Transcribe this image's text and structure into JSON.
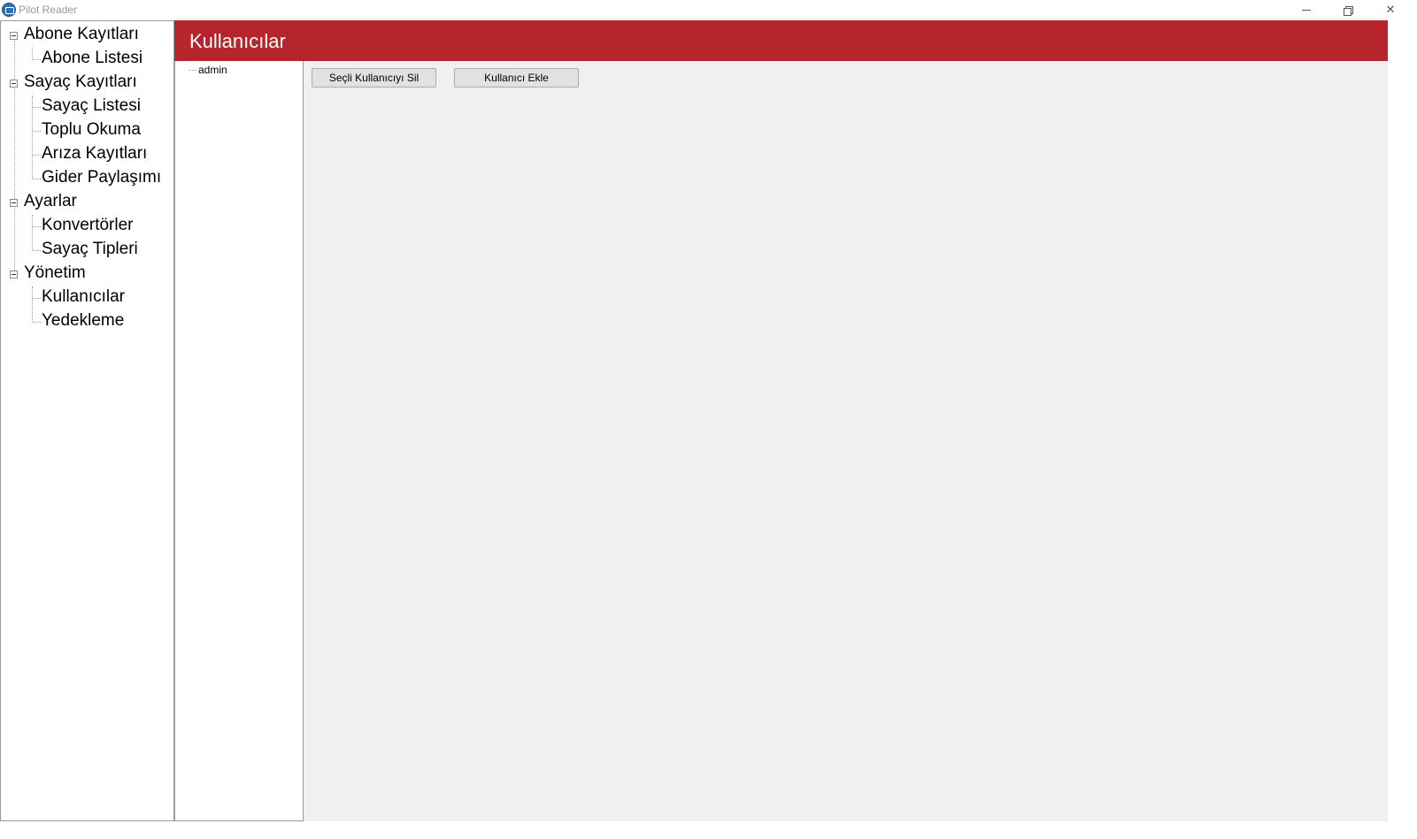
{
  "window": {
    "title": "Pilot Reader",
    "app_icon": "app-logo-icon",
    "controls": [
      "minimize-icon",
      "restore-icon",
      "close-icon"
    ]
  },
  "nav": {
    "groups": [
      {
        "label": "Abone Kayıtları",
        "children": [
          "Abone Listesi"
        ]
      },
      {
        "label": "Sayaç Kayıtları",
        "children": [
          "Sayaç Listesi",
          "Toplu Okuma",
          "Arıza Kayıtları",
          "Gider Paylaşımı"
        ]
      },
      {
        "label": "Ayarlar",
        "children": [
          "Konvertörler",
          "Sayaç Tipleri"
        ]
      },
      {
        "label": "Yönetim",
        "children": [
          "Kullanıcılar",
          "Yedekleme"
        ]
      }
    ]
  },
  "header": {
    "title": "Kullanıcılar",
    "color": "#b5252b"
  },
  "users": {
    "items": [
      "admin"
    ]
  },
  "toolbar": {
    "delete_label": "Seçli Kullanıcıyı Sil",
    "add_label": "Kullanıcı Ekle"
  }
}
